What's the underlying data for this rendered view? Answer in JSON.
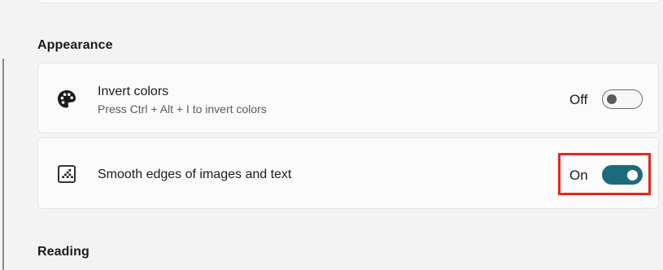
{
  "sections": {
    "appearance_title": "Appearance",
    "reading_title": "Reading"
  },
  "settings": {
    "invert_colors": {
      "title": "Invert colors",
      "description": "Press Ctrl + Alt + I to invert colors",
      "state_label": "Off",
      "enabled": false,
      "icon": "palette-icon"
    },
    "smooth_edges": {
      "title": "Smooth edges of images and text",
      "state_label": "On",
      "enabled": true,
      "icon": "smooth-edges-icon"
    }
  },
  "colors": {
    "toggle_on": "#1c6b7c",
    "highlight": "#e4291e",
    "background": "#f3f3f3"
  }
}
